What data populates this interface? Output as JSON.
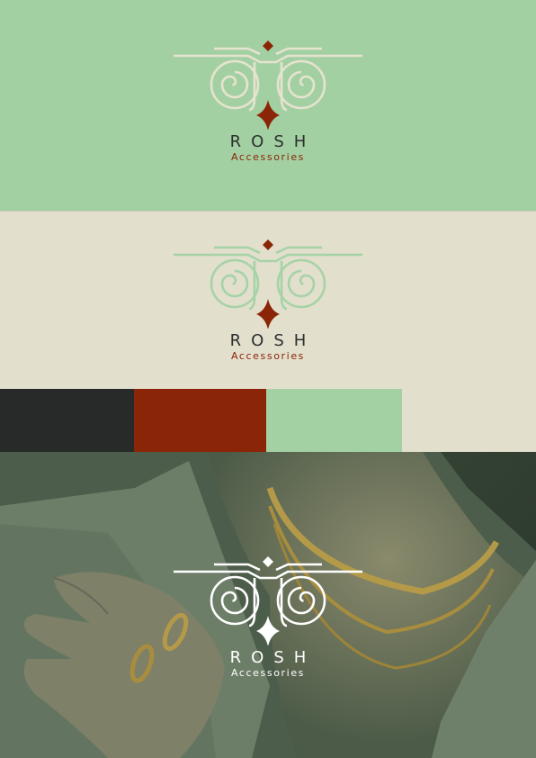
{
  "brand": {
    "name": "ROSH",
    "subtitle": "Accessories"
  },
  "palette": {
    "charcoal": "#282a2a",
    "rust": "#8b2507",
    "mint": "#a4d1a4",
    "cream": "#e2dfcd"
  },
  "panels": [
    {
      "background": "#a3d0a2",
      "ornament_color": "#e6e3d0",
      "diamond_color": "#8b2507",
      "name_color": "#2c2f2e",
      "subtitle_color": "#8b2507"
    },
    {
      "background": "#e2dfcd",
      "ornament_color": "#a6d3a6",
      "diamond_color": "#8b2507",
      "name_color": "#2c2f2e",
      "subtitle_color": "#8b2507"
    },
    {
      "background": "photo",
      "ornament_color": "#ffffff",
      "diamond_color": "#ffffff",
      "name_color": "#ffffff",
      "subtitle_color": "#ffffff"
    }
  ]
}
